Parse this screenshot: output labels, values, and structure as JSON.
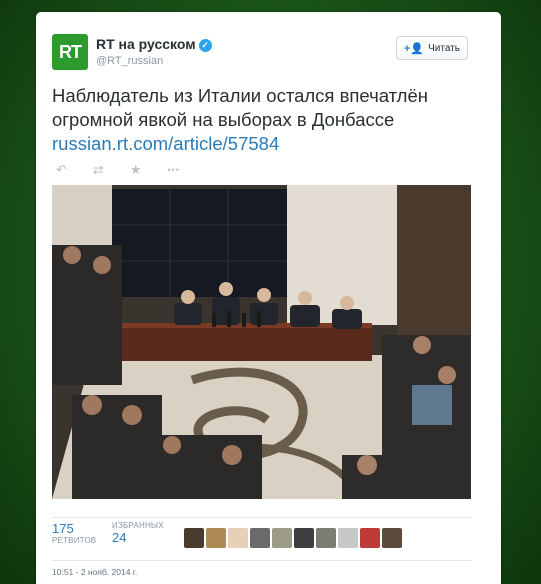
{
  "author": {
    "logo_text": "RT",
    "name": "RT на русском",
    "handle": "@RT_russian"
  },
  "follow_button": {
    "label": "Читать"
  },
  "tweet": {
    "text": "Наблюдатель из Италии остался впечатлён огромной явкой на выборах в Донбассе",
    "link": "russian.rt.com/article/57584"
  },
  "actions": {
    "reply_icon": "reply-icon",
    "retweet_icon": "retweet-icon",
    "favorite_icon": "star-icon",
    "more_icon": "more-icon",
    "reply_glyph": "↶",
    "retweet_glyph": "⇄",
    "favorite_glyph": "★",
    "more_glyph": "•••"
  },
  "stats": {
    "retweets_count": "175",
    "retweets_label": "РЕТВИТОВ",
    "favorites_count": "24",
    "favorites_label": "ИЗБРАННЫХ"
  },
  "favorited_by_avatars": [
    "#4a3b2f",
    "#b08a55",
    "#e8d0b8",
    "#6a6a6a",
    "#9c9c88",
    "#3e3e3e",
    "#7c7c70",
    "#c8c8c8",
    "#c03a3a",
    "#5e4a3a"
  ],
  "timestamp": "10:51 - 2 нояб. 2014 г.",
  "colors": {
    "background_green": "#1d5a1b",
    "rt_logo": "#2d9a2d",
    "link_blue": "#2b7bb9",
    "text": "#292f33"
  }
}
